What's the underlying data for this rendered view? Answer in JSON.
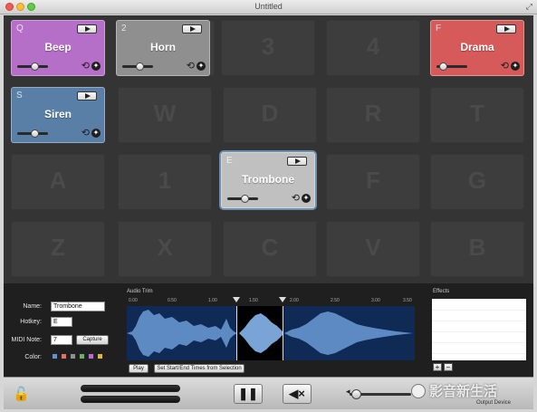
{
  "window": {
    "title": "Untitled"
  },
  "ghost_keys": [
    "3",
    "4",
    "W",
    "D",
    "R",
    "T",
    "A",
    "1",
    "F",
    "G",
    "Z",
    "X",
    "C",
    "V",
    "B"
  ],
  "pads": [
    {
      "key": "Q",
      "name": "Beep",
      "color": "#b66fc9",
      "volume": 0.55
    },
    {
      "key": "2",
      "name": "Horn",
      "color": "#8f8f8f",
      "volume": 0.55
    },
    {
      "key": "F",
      "name": "Drama",
      "color": "#d65a5a",
      "volume": 0.2
    },
    {
      "key": "S",
      "name": "Siren",
      "color": "#5a7fa7",
      "volume": 0.55
    },
    {
      "key": "E",
      "name": "Trombone",
      "color": "#c0c0c0",
      "volume": 0.55
    }
  ],
  "editor": {
    "name_label": "Name:",
    "name_value": "Trombone",
    "hotkey_label": "Hotkey:",
    "hotkey_value": "E",
    "midi_label": "MIDI Note:",
    "midi_value": "7",
    "capture_label": "Capture",
    "color_label": "Color:",
    "swatches": [
      "#6a8fc2",
      "#d9736e",
      "#8f8f8f",
      "#6fae6a",
      "#b66fc9",
      "#d9b54f"
    ]
  },
  "audio_trim": {
    "title": "Audio Trim",
    "ruler": [
      "0.00",
      "0.50",
      "1.00",
      "1.50",
      "2.00",
      "2.50",
      "3.00",
      "3.50"
    ],
    "play_label": "Play",
    "set_times_label": "Set Start/End Times from Selection"
  },
  "effects": {
    "title": "Effects",
    "add_label": "+",
    "remove_label": "−"
  },
  "footer": {
    "pause_label": "❚❚",
    "mute_label": "◀×",
    "output_device_label": "Output Device",
    "master_volume": 0.1,
    "watermark": "影音新生活"
  }
}
